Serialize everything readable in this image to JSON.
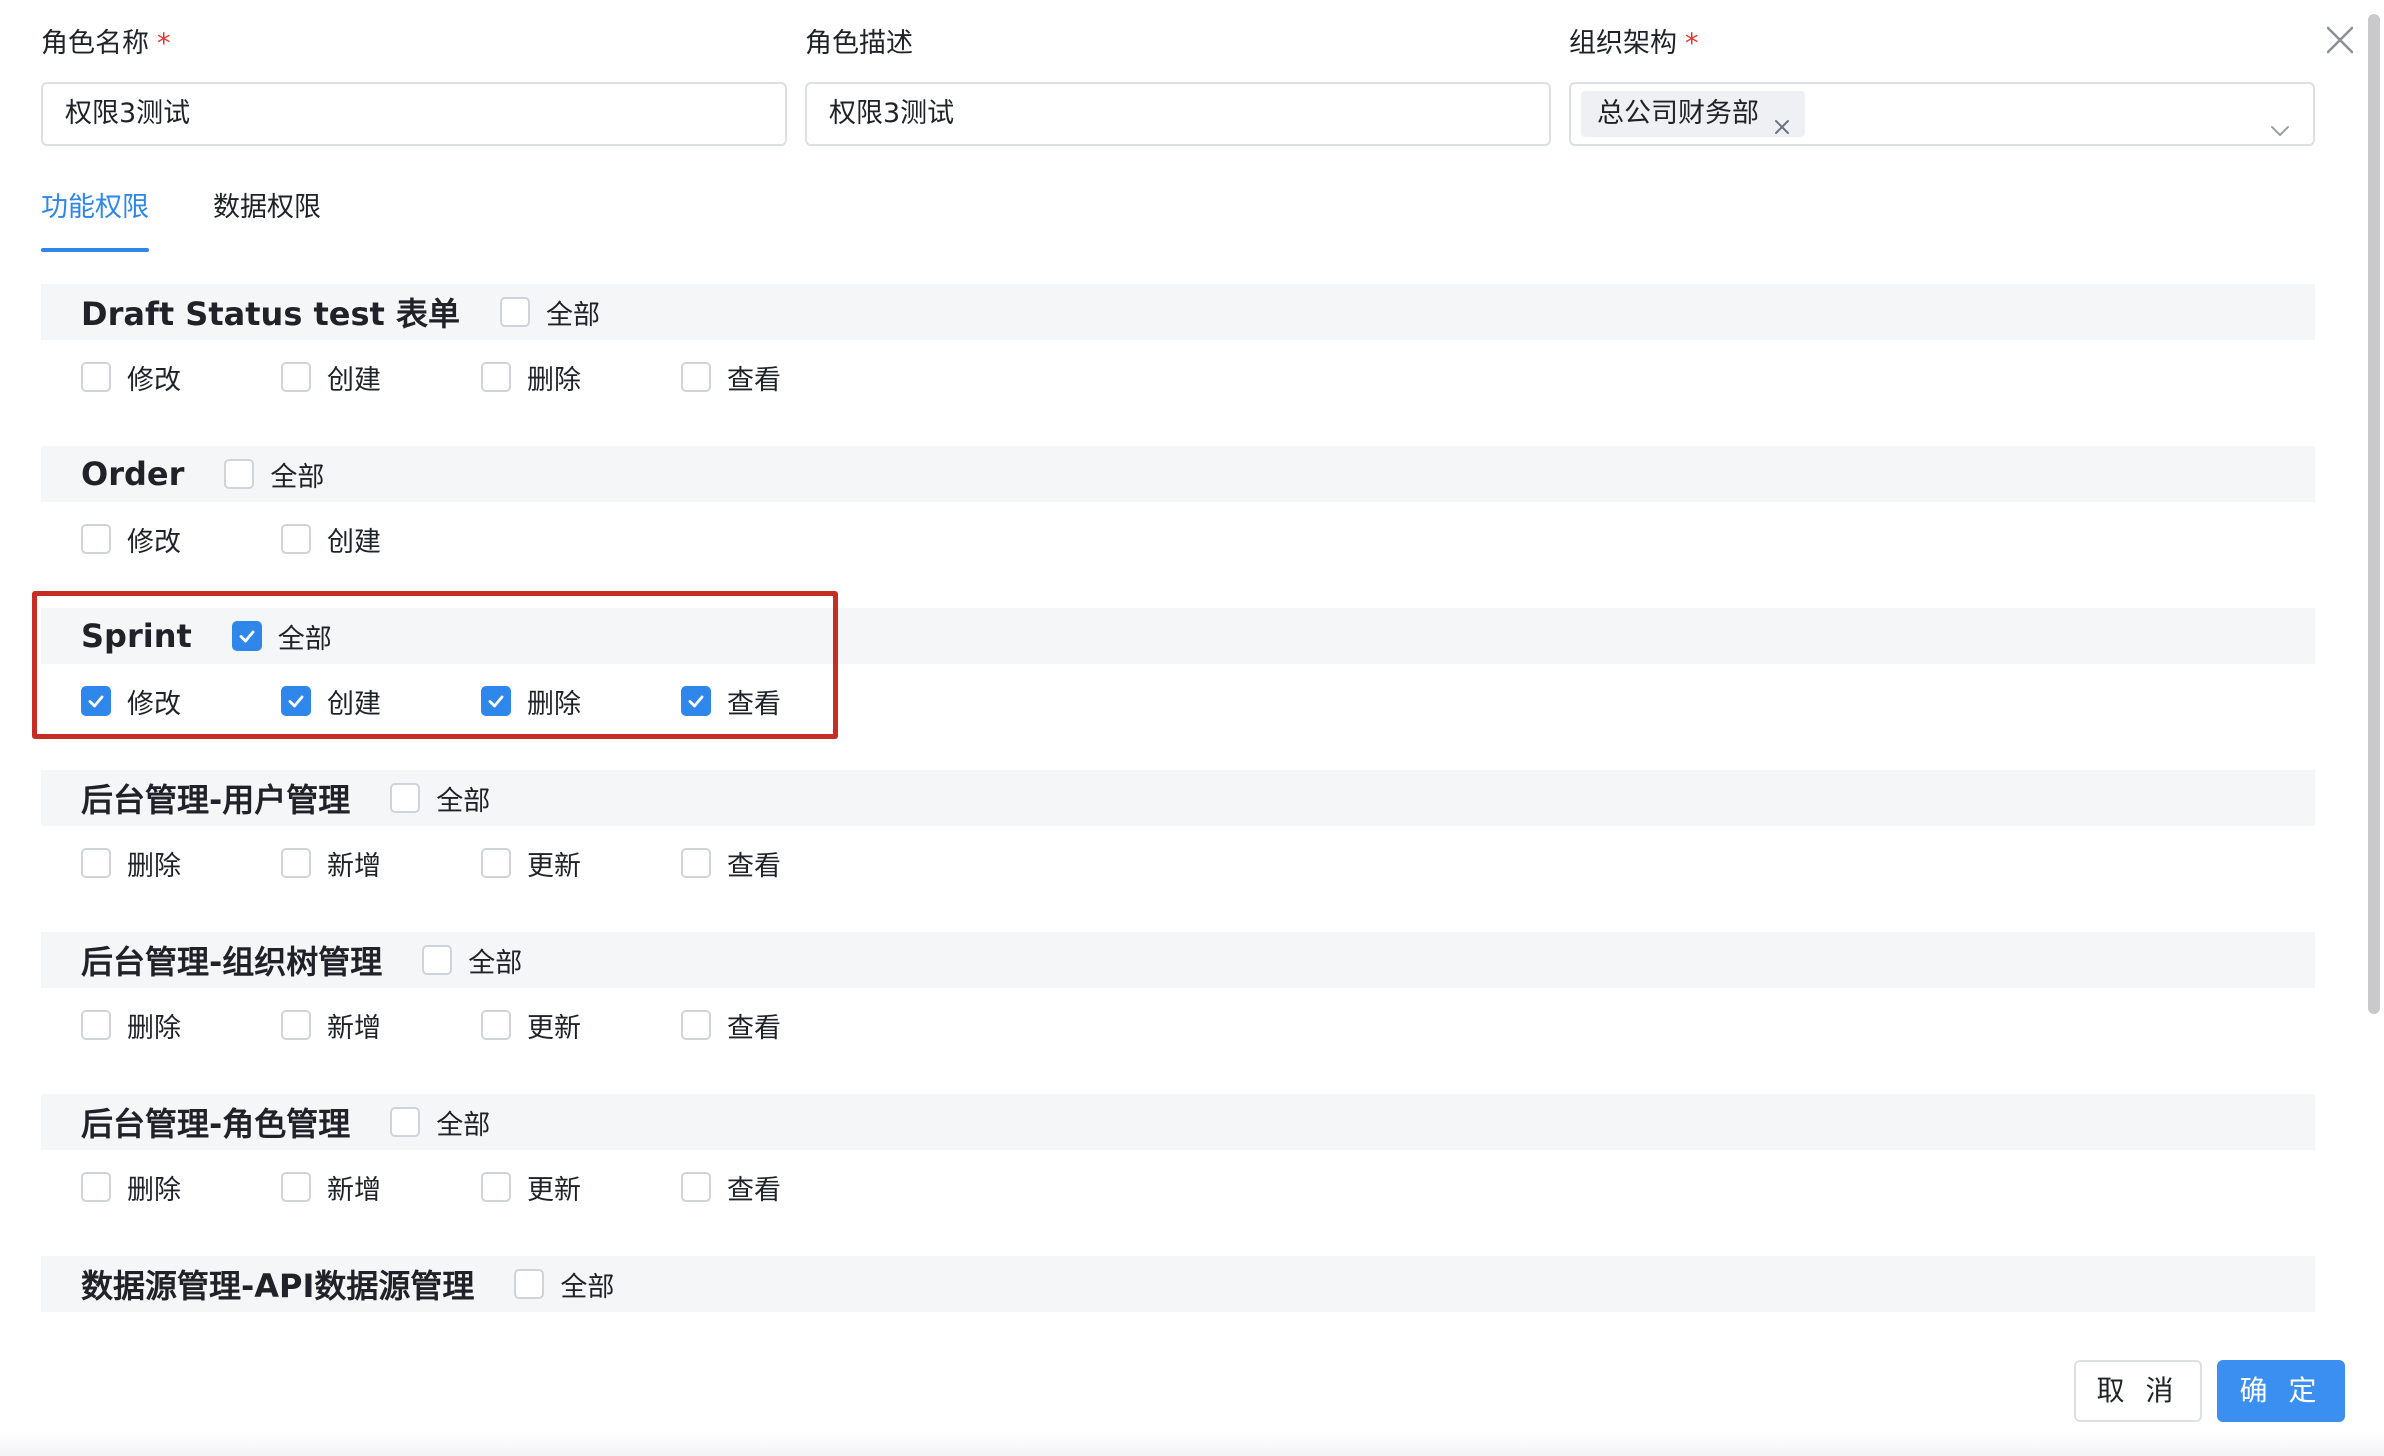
{
  "form": {
    "role_name": {
      "label": "角色名称",
      "required_mark": "*",
      "value": "权限3测试"
    },
    "role_desc": {
      "label": "角色描述",
      "value": "权限3测试"
    },
    "org": {
      "label": "组织架构",
      "required_mark": "*",
      "tag": "总公司财务部"
    }
  },
  "tabs": [
    {
      "label": "功能权限",
      "active": true
    },
    {
      "label": "数据权限",
      "active": false
    }
  ],
  "groups": [
    {
      "title": "Draft Status test 表单",
      "all_label": "全部",
      "all_checked": false,
      "perms": [
        {
          "label": "修改",
          "checked": false
        },
        {
          "label": "创建",
          "checked": false
        },
        {
          "label": "删除",
          "checked": false
        },
        {
          "label": "查看",
          "checked": false
        }
      ]
    },
    {
      "title": "Order",
      "all_label": "全部",
      "all_checked": false,
      "perms": [
        {
          "label": "修改",
          "checked": false
        },
        {
          "label": "创建",
          "checked": false
        }
      ]
    },
    {
      "title": "Sprint",
      "all_label": "全部",
      "all_checked": true,
      "perms": [
        {
          "label": "修改",
          "checked": true
        },
        {
          "label": "创建",
          "checked": true
        },
        {
          "label": "删除",
          "checked": true
        },
        {
          "label": "查看",
          "checked": true
        }
      ]
    },
    {
      "title": "后台管理-用户管理",
      "all_label": "全部",
      "all_checked": false,
      "perms": [
        {
          "label": "删除",
          "checked": false
        },
        {
          "label": "新增",
          "checked": false
        },
        {
          "label": "更新",
          "checked": false
        },
        {
          "label": "查看",
          "checked": false
        }
      ]
    },
    {
      "title": "后台管理-组织树管理",
      "all_label": "全部",
      "all_checked": false,
      "perms": [
        {
          "label": "删除",
          "checked": false
        },
        {
          "label": "新增",
          "checked": false
        },
        {
          "label": "更新",
          "checked": false
        },
        {
          "label": "查看",
          "checked": false
        }
      ]
    },
    {
      "title": "后台管理-角色管理",
      "all_label": "全部",
      "all_checked": false,
      "perms": [
        {
          "label": "删除",
          "checked": false
        },
        {
          "label": "新增",
          "checked": false
        },
        {
          "label": "更新",
          "checked": false
        },
        {
          "label": "查看",
          "checked": false
        }
      ]
    },
    {
      "title": "数据源管理-API数据源管理",
      "all_label": "全部",
      "all_checked": false,
      "perms": [
        {
          "label": "",
          "checked": false
        },
        {
          "label": "",
          "checked": false
        },
        {
          "label": "",
          "checked": false
        },
        {
          "label": "",
          "checked": false
        }
      ]
    }
  ],
  "footer": {
    "cancel_label": "取 消",
    "ok_label": "确 定"
  },
  "colors": {
    "accent": "#2f86eb",
    "highlight": "#c62e25",
    "required": "#e3342f",
    "group_header_bg": "#f5f6f7"
  },
  "icons": {
    "close": "close-icon",
    "select_arrow": "chevron-down-icon",
    "tag_remove": "tag-close-icon",
    "check": "check-icon"
  }
}
